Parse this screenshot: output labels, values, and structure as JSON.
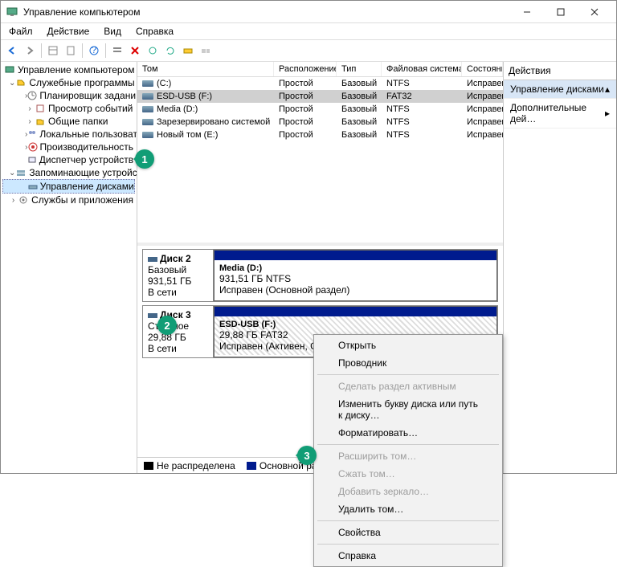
{
  "window": {
    "title": "Управление компьютером"
  },
  "menubar": [
    "Файл",
    "Действие",
    "Вид",
    "Справка"
  ],
  "tree": {
    "root": "Управление компьютером (л",
    "g1": "Служебные программы",
    "g1_items": [
      "Планировщик задани",
      "Просмотр событий",
      "Общие папки",
      "Локальные пользоват",
      "Производительность",
      "Диспетчер устройств"
    ],
    "g2": "Запоминающие устройст",
    "g2_item": "Управление дисками",
    "g3": "Службы и приложения"
  },
  "columns": {
    "c0": "Том",
    "c1": "Расположение",
    "c2": "Тип",
    "c3": "Файловая система",
    "c4": "Состояние"
  },
  "volumes": [
    {
      "name": "(C:)",
      "layout": "Простой",
      "type": "Базовый",
      "fs": "NTFS",
      "status": "Исправен (Загрузка, Файл"
    },
    {
      "name": "ESD-USB (F:)",
      "layout": "Простой",
      "type": "Базовый",
      "fs": "FAT32",
      "status": "Исправен (Активен, Осн"
    },
    {
      "name": "Media (D:)",
      "layout": "Простой",
      "type": "Базовый",
      "fs": "NTFS",
      "status": "Исправен (Основной разд"
    },
    {
      "name": "Зарезервировано системой",
      "layout": "Простой",
      "type": "Базовый",
      "fs": "NTFS",
      "status": "Исправен (Система, Актив"
    },
    {
      "name": "Новый том (E:)",
      "layout": "Простой",
      "type": "Базовый",
      "fs": "NTFS",
      "status": "Исправен (Основной разд"
    }
  ],
  "disks": {
    "d2": {
      "name": "Диск 2",
      "type": "Базовый",
      "size": "931,51 ГБ",
      "state": "В сети",
      "part_name": "Media  (D:)",
      "part_size": "931,51 ГБ NTFS",
      "part_status": "Исправен (Основной раздел)"
    },
    "d3": {
      "name": "Диск 3",
      "type": "Съемное",
      "size": "29,88 ГБ",
      "state": "В сети",
      "part_name": "ESD-USB  (F:)",
      "part_size": "29,88 ГБ FAT32",
      "part_status": "Исправен (Активен, Основной раз"
    }
  },
  "legend": {
    "unalloc": "Не распределена",
    "primary": "Основной раздел"
  },
  "actions": {
    "head": "Действия",
    "i1": "Управление дисками",
    "i2": "Дополнительные дей…"
  },
  "context": {
    "open": "Открыть",
    "explorer": "Проводник",
    "active": "Сделать раздел активным",
    "letter": "Изменить букву диска или путь к диску…",
    "format": "Форматировать…",
    "extend": "Расширить том…",
    "shrink": "Сжать том…",
    "mirror": "Добавить зеркало…",
    "delete": "Удалить том…",
    "props": "Свойства",
    "help": "Справка"
  },
  "callouts": {
    "c1": "1",
    "c2": "2",
    "c3": "3"
  }
}
